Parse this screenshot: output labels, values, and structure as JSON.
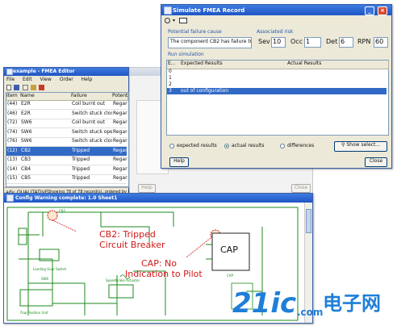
{
  "simulate_dialog": {
    "title": "Simulate FMEA Record",
    "potential_failure_cause_label": "Potential failure cause",
    "potential_failure_cause_value": "The component CB2 has failure tripp",
    "associated_risk_label": "Associated risk",
    "sev_label": "Sev",
    "sev_value": "10",
    "occ_label": "Occ",
    "occ_value": "1",
    "det_label": "Det",
    "det_value": "6",
    "rpn_label": "RPN",
    "rpn_value": "60",
    "run_simulation_label": "Run simulation",
    "columns": [
      "E...",
      "Expected Results",
      "Actual Results"
    ],
    "rows": [
      {
        "e": "0",
        "expected": "",
        "actual": ""
      },
      {
        "e": "1",
        "expected": "",
        "actual": ""
      },
      {
        "e": "2",
        "expected": "",
        "actual": ""
      },
      {
        "e": "3",
        "expected": "out of configuration",
        "actual": ""
      }
    ],
    "radio_options": [
      "expected results",
      "actual results",
      "differences"
    ],
    "selected_radio": "actual results",
    "show_select_label": "Show select...",
    "help_label": "Help",
    "close_label": "Close"
  },
  "fmea_editor": {
    "title": "example - FMEA Editor",
    "menu": [
      "File",
      "Edit",
      "View",
      "Order",
      "Help"
    ],
    "columns": [
      "Item",
      "Name",
      "Failure",
      "Potential"
    ],
    "rows": [
      {
        "item": "(44)",
        "name": "E2R",
        "failure": "Coil burnt out",
        "potential": "Regardle..."
      },
      {
        "item": "(46)",
        "name": "E2R",
        "failure": "Switch stuck closed",
        "potential": "Regardle..."
      },
      {
        "item": "(72)",
        "name": "SW6",
        "failure": "Coil burnt out",
        "potential": "Regardle..."
      },
      {
        "item": "(74)",
        "name": "SW6",
        "failure": "Switch stuck open",
        "potential": "Regardle..."
      },
      {
        "item": "(76)",
        "name": "SW6",
        "failure": "Switch stuck closed",
        "potential": "Regardle..."
      },
      {
        "item": "(12)",
        "name": "CB2",
        "failure": "Tripped",
        "potential": "Regardle..."
      },
      {
        "item": "(13)",
        "name": "CB3",
        "failure": "Tripped",
        "potential": "Regardle..."
      },
      {
        "item": "(14)",
        "name": "CB4",
        "failure": "Tripped",
        "potential": "Regardle..."
      },
      {
        "item": "(15)",
        "name": "CB5",
        "failure": "Tripped",
        "potential": "Regardle..."
      }
    ],
    "selected_row_index": 5,
    "status": [
      "ady",
      "QUALITATIVE",
      "Showing 78 of 78 record(s), ordered by RPN"
    ]
  },
  "background_window": {
    "help_label": "Help",
    "close_label": "Close"
  },
  "config_window": {
    "title": "Config Warning complete: 1.0 Sheet1",
    "cap_label": "CAP",
    "cap_sublabel": "CAP",
    "annotations": {
      "cb2_line1": "CB2: Tripped",
      "cb2_line2": "Circuit Breaker",
      "cap_line1": "CAP: No",
      "cap_line2": "Indication to Pilot"
    },
    "schematic_labels": [
      "Landing Gear Switch",
      "Speedbrake Actuator",
      "Flap Position Unit",
      "CB2",
      "SW6"
    ]
  },
  "watermark": {
    "brand": "21ic",
    "suffix": ".com",
    "cn": "电子网"
  },
  "colors": {
    "title_blue": "#1f55c4",
    "selection": "#316ac5",
    "annotation_red": "#d01818",
    "schematic_green": "#1c8a1c",
    "watermark_blue": "#1e7fd8"
  }
}
